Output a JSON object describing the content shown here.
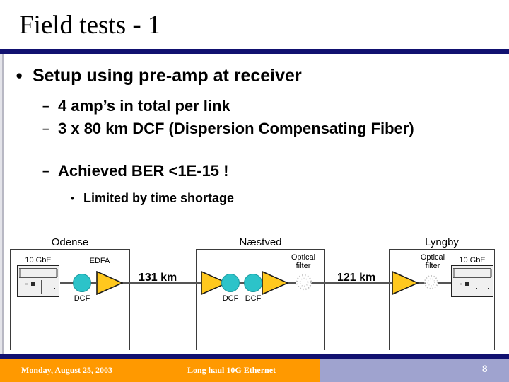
{
  "slide": {
    "title": "Field tests - 1",
    "page_number": "8"
  },
  "content": {
    "level1": [
      {
        "bullet": "●",
        "text": "Setup using pre-amp at receiver"
      }
    ],
    "level2": [
      {
        "bullet": "–",
        "text": "4 amp’s in total per link"
      },
      {
        "bullet": "–",
        "text": "3 x 80 km DCF (Dispersion Compensating Fiber)"
      },
      {
        "bullet": "–",
        "text": "Achieved BER  <1E-15 !"
      }
    ],
    "level3": [
      {
        "bullet": "•",
        "text": "Limited by time shortage"
      }
    ]
  },
  "diagram": {
    "stations": [
      {
        "name": "Odense"
      },
      {
        "name": "Næstved"
      },
      {
        "name": "Lyngby"
      }
    ],
    "spans": [
      {
        "length": "131 km"
      },
      {
        "length": "121 km"
      }
    ],
    "terminals": [
      {
        "label": "10 GbE"
      },
      {
        "label": "10 GbE"
      }
    ],
    "amplifiers": [
      {
        "label": "EDFA"
      },
      {
        "label": ""
      },
      {
        "label": ""
      },
      {
        "label": ""
      }
    ],
    "dcf_modules": [
      {
        "label": "DCF"
      },
      {
        "label": "DCF"
      },
      {
        "label": "DCF"
      }
    ],
    "optical_filters": [
      {
        "line1": "Optical",
        "line2": "filter"
      },
      {
        "line1": "Optical",
        "line2": "filter"
      }
    ]
  },
  "footer": {
    "date": "Monday, August 25, 2003",
    "subject": "Long haul 10G Ethernet"
  },
  "colors": {
    "navy": "#111170",
    "orange": "#FF9900",
    "lavender": "#9fa3cf",
    "amp_yellow": "#FFC81E",
    "dcf_cyan": "#2CC3C9"
  }
}
